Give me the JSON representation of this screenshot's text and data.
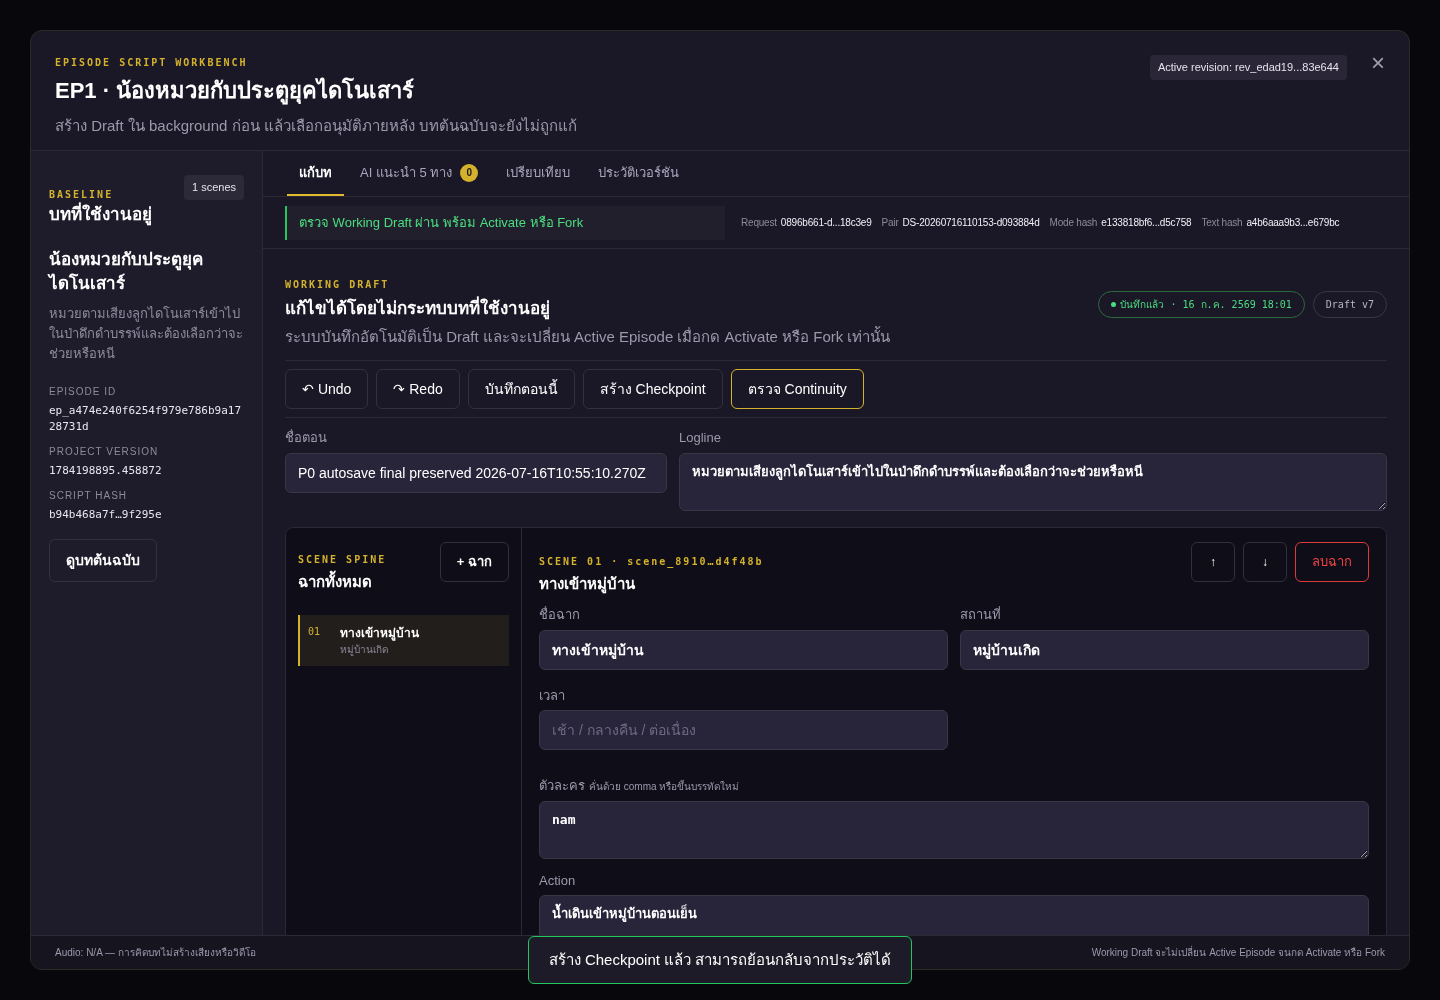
{
  "header": {
    "eyebrow": "EPISODE SCRIPT WORKBENCH",
    "title": "EP1 · น้องหมวยกับประตูยุคไดโนเสาร์",
    "subtitle": "สร้าง Draft ใน background ก่อน แล้วเลือกอนุมัติภายหลัง บทต้นฉบับจะยังไม่ถูกแก้",
    "revision_badge": "Active revision: rev_edad19...83e644",
    "close": "×"
  },
  "sidebar": {
    "eyebrow": "BASELINE",
    "scene_count": "1 scenes",
    "heading": "บทที่ใช้งานอยู่",
    "episode_title": "น้องหมวยกับประตูยุคไดโนเสาร์",
    "logline": "หมวยตามเสียงลูกไดโนเสาร์เข้าไปในป่าดึกดำบรรพ์และต้องเลือกว่าจะช่วยหรือหนี",
    "meta": [
      {
        "label": "EPISODE ID",
        "value": "ep_a474e240f6254f979e786b9a1728731d"
      },
      {
        "label": "PROJECT VERSION",
        "value": "1784198895.458872"
      },
      {
        "label": "SCRIPT HASH",
        "value": "b94b468a7f…9f295e"
      }
    ],
    "button": "ดูบทต้นฉบับ"
  },
  "tabs": [
    {
      "label": "แก้บท",
      "selected": true
    },
    {
      "label": "AI แนะนำ 5 ทาง",
      "badge": "0",
      "selected": false
    },
    {
      "label": "เปรียบเทียบ",
      "selected": false
    },
    {
      "label": "ประวัติเวอร์ชัน",
      "selected": false
    }
  ],
  "status": {
    "message": "ตรวจ Working Draft ผ่าน พร้อม Activate หรือ Fork",
    "meta": [
      {
        "label": "Request",
        "value": "0896b661-d...18c3e9"
      },
      {
        "label": "Pair",
        "value": "DS-20260716110153-d093884d"
      },
      {
        "label": "Mode hash",
        "value": "e133818bf6...d5c758"
      },
      {
        "label": "Text hash",
        "value": "a4b6aaa9b3...e679bc"
      }
    ]
  },
  "draft": {
    "eyebrow": "WORKING DRAFT",
    "title": "แก้ไขได้โดยไม่กระทบบทที่ใช้งานอยู่",
    "description": "ระบบบันทึกอัตโนมัติเป็น Draft และจะเปลี่ยน Active Episode เมื่อกด Activate หรือ Fork เท่านั้น",
    "saved_badge": "บันทึกแล้ว · 16 ก.ค. 2569 18:01",
    "version_badge": "Draft v7",
    "actions": [
      {
        "label": "↶ Undo",
        "highlighted": false
      },
      {
        "label": "↷ Redo",
        "highlighted": false
      },
      {
        "label": "บันทึกตอนนี้",
        "highlighted": false
      },
      {
        "label": "สร้าง Checkpoint",
        "highlighted": false
      },
      {
        "label": "ตรวจ Continuity",
        "highlighted": true
      }
    ],
    "episode_name": {
      "label": "ชื่อตอน",
      "value": "P0 autosave final preserved 2026-07-16T10:55:10.270Z"
    },
    "logline": {
      "label": "Logline",
      "value": "หมวยตามเสียงลูกไดโนเสาร์เข้าไปในป่าดึกดำบรรพ์และต้องเลือกว่าจะช่วยหรือหนี"
    }
  },
  "spine": {
    "eyebrow": "SCENE SPINE",
    "title": "ฉากทั้งหมด",
    "add_button": "+ ฉาก",
    "scenes": [
      {
        "number": "01",
        "title": "ทางเข้าหมู่บ้าน",
        "location": "หมู่บ้านเกิด",
        "selected": true
      }
    ]
  },
  "scene": {
    "eyebrow": "SCENE 01 · scene_8910…d4f48b",
    "title": "ทางเข้าหมู่บ้าน",
    "move_up": "↑",
    "move_down": "↓",
    "delete": "ลบฉาก",
    "name": {
      "label": "ชื่อฉาก",
      "value": "ทางเข้าหมู่บ้าน"
    },
    "location": {
      "label": "สถานที่",
      "value": "หมู่บ้านเกิด"
    },
    "time": {
      "label": "เวลา",
      "placeholder": "เช้า / กลางคืน / ต่อเนื่อง"
    },
    "characters": {
      "label": "ตัวละคร",
      "hint": "คั่นด้วย comma หรือขึ้นบรรทัดใหม่",
      "value": "nam"
    },
    "action": {
      "label": "Action",
      "value": "น้ำเดินเข้าหมู่บ้านตอนเย็น"
    }
  },
  "footer": {
    "left": "Audio: N/A — การคิดบทไม่สร้างเสียงหรือวิดีโอ",
    "right": "Working Draft จะไม่เปลี่ยน Active Episode จนกด Activate หรือ Fork"
  },
  "toast": "สร้าง Checkpoint แล้ว สามารถย้อนกลับจากประวัติได้"
}
